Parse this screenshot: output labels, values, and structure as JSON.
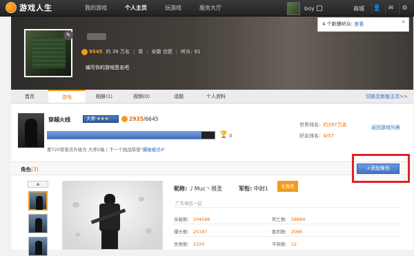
{
  "topbar": {
    "logo_text": "游戏人生",
    "nav": [
      "我的游戏",
      "个人主页",
      "玩游戏",
      "服务大厅"
    ],
    "user_name": "boy",
    "shop_label": "商城"
  },
  "notification": {
    "text": "4 个新爆听众: ",
    "link": "查看",
    "close": "×"
  },
  "profile": {
    "coins": "9545",
    "about": "约 39 万名",
    "gender": "男",
    "location": "安徽 合肥",
    "listeners_label": "听众:",
    "listeners": "91",
    "signature": "编写你的游戏签名吧"
  },
  "tabs": [
    "首页",
    "游戏",
    "相册(1)",
    "视频(0)",
    "话题",
    "个人资料"
  ],
  "active_tab": "游戏",
  "switch_link": "切换至新版主页>>",
  "game": {
    "name": "穿越火线",
    "rank_label": "大师",
    "rank_stars": "★★★",
    "score_current": "2935",
    "score_total": "/6645",
    "xp_fraction": 0.92,
    "trophy_count": "0",
    "upgrade_prefix": "差720荣誉点升级为 大师2级丨下一个挑战荣誉",
    "upgrade_link": "\"爆破模式4\"",
    "world_rank_label": "世界排名:",
    "world_rank": "约397万名",
    "friend_rank_label": "好友排名:",
    "friend_rank": "4/57",
    "back_link": "返回游戏列表"
  },
  "roles": {
    "title": "角色",
    "count": "(3)",
    "add_button": "+添加角色",
    "col_up": "▲",
    "nick_label": "昵称:",
    "nick": "丿Muc丶贱圣",
    "mil_label": "军衔:",
    "mil": "中尉1",
    "main_tag": "主角色",
    "server": "广东电信一区",
    "stats": [
      {
        "label": "杀敌数:",
        "value": "104586"
      },
      {
        "label": "死亡数:",
        "value": "58884"
      },
      {
        "label": "爆头数:",
        "value": "25197"
      },
      {
        "label": "胜利数:",
        "value": "2086"
      },
      {
        "label": "失败数:",
        "value": "2320"
      },
      {
        "label": "平局数:",
        "value": "12"
      }
    ]
  },
  "colors": {
    "accent": "#f39a1e",
    "link": "#2a6cc0",
    "highlight_frame": "#e0202a"
  }
}
